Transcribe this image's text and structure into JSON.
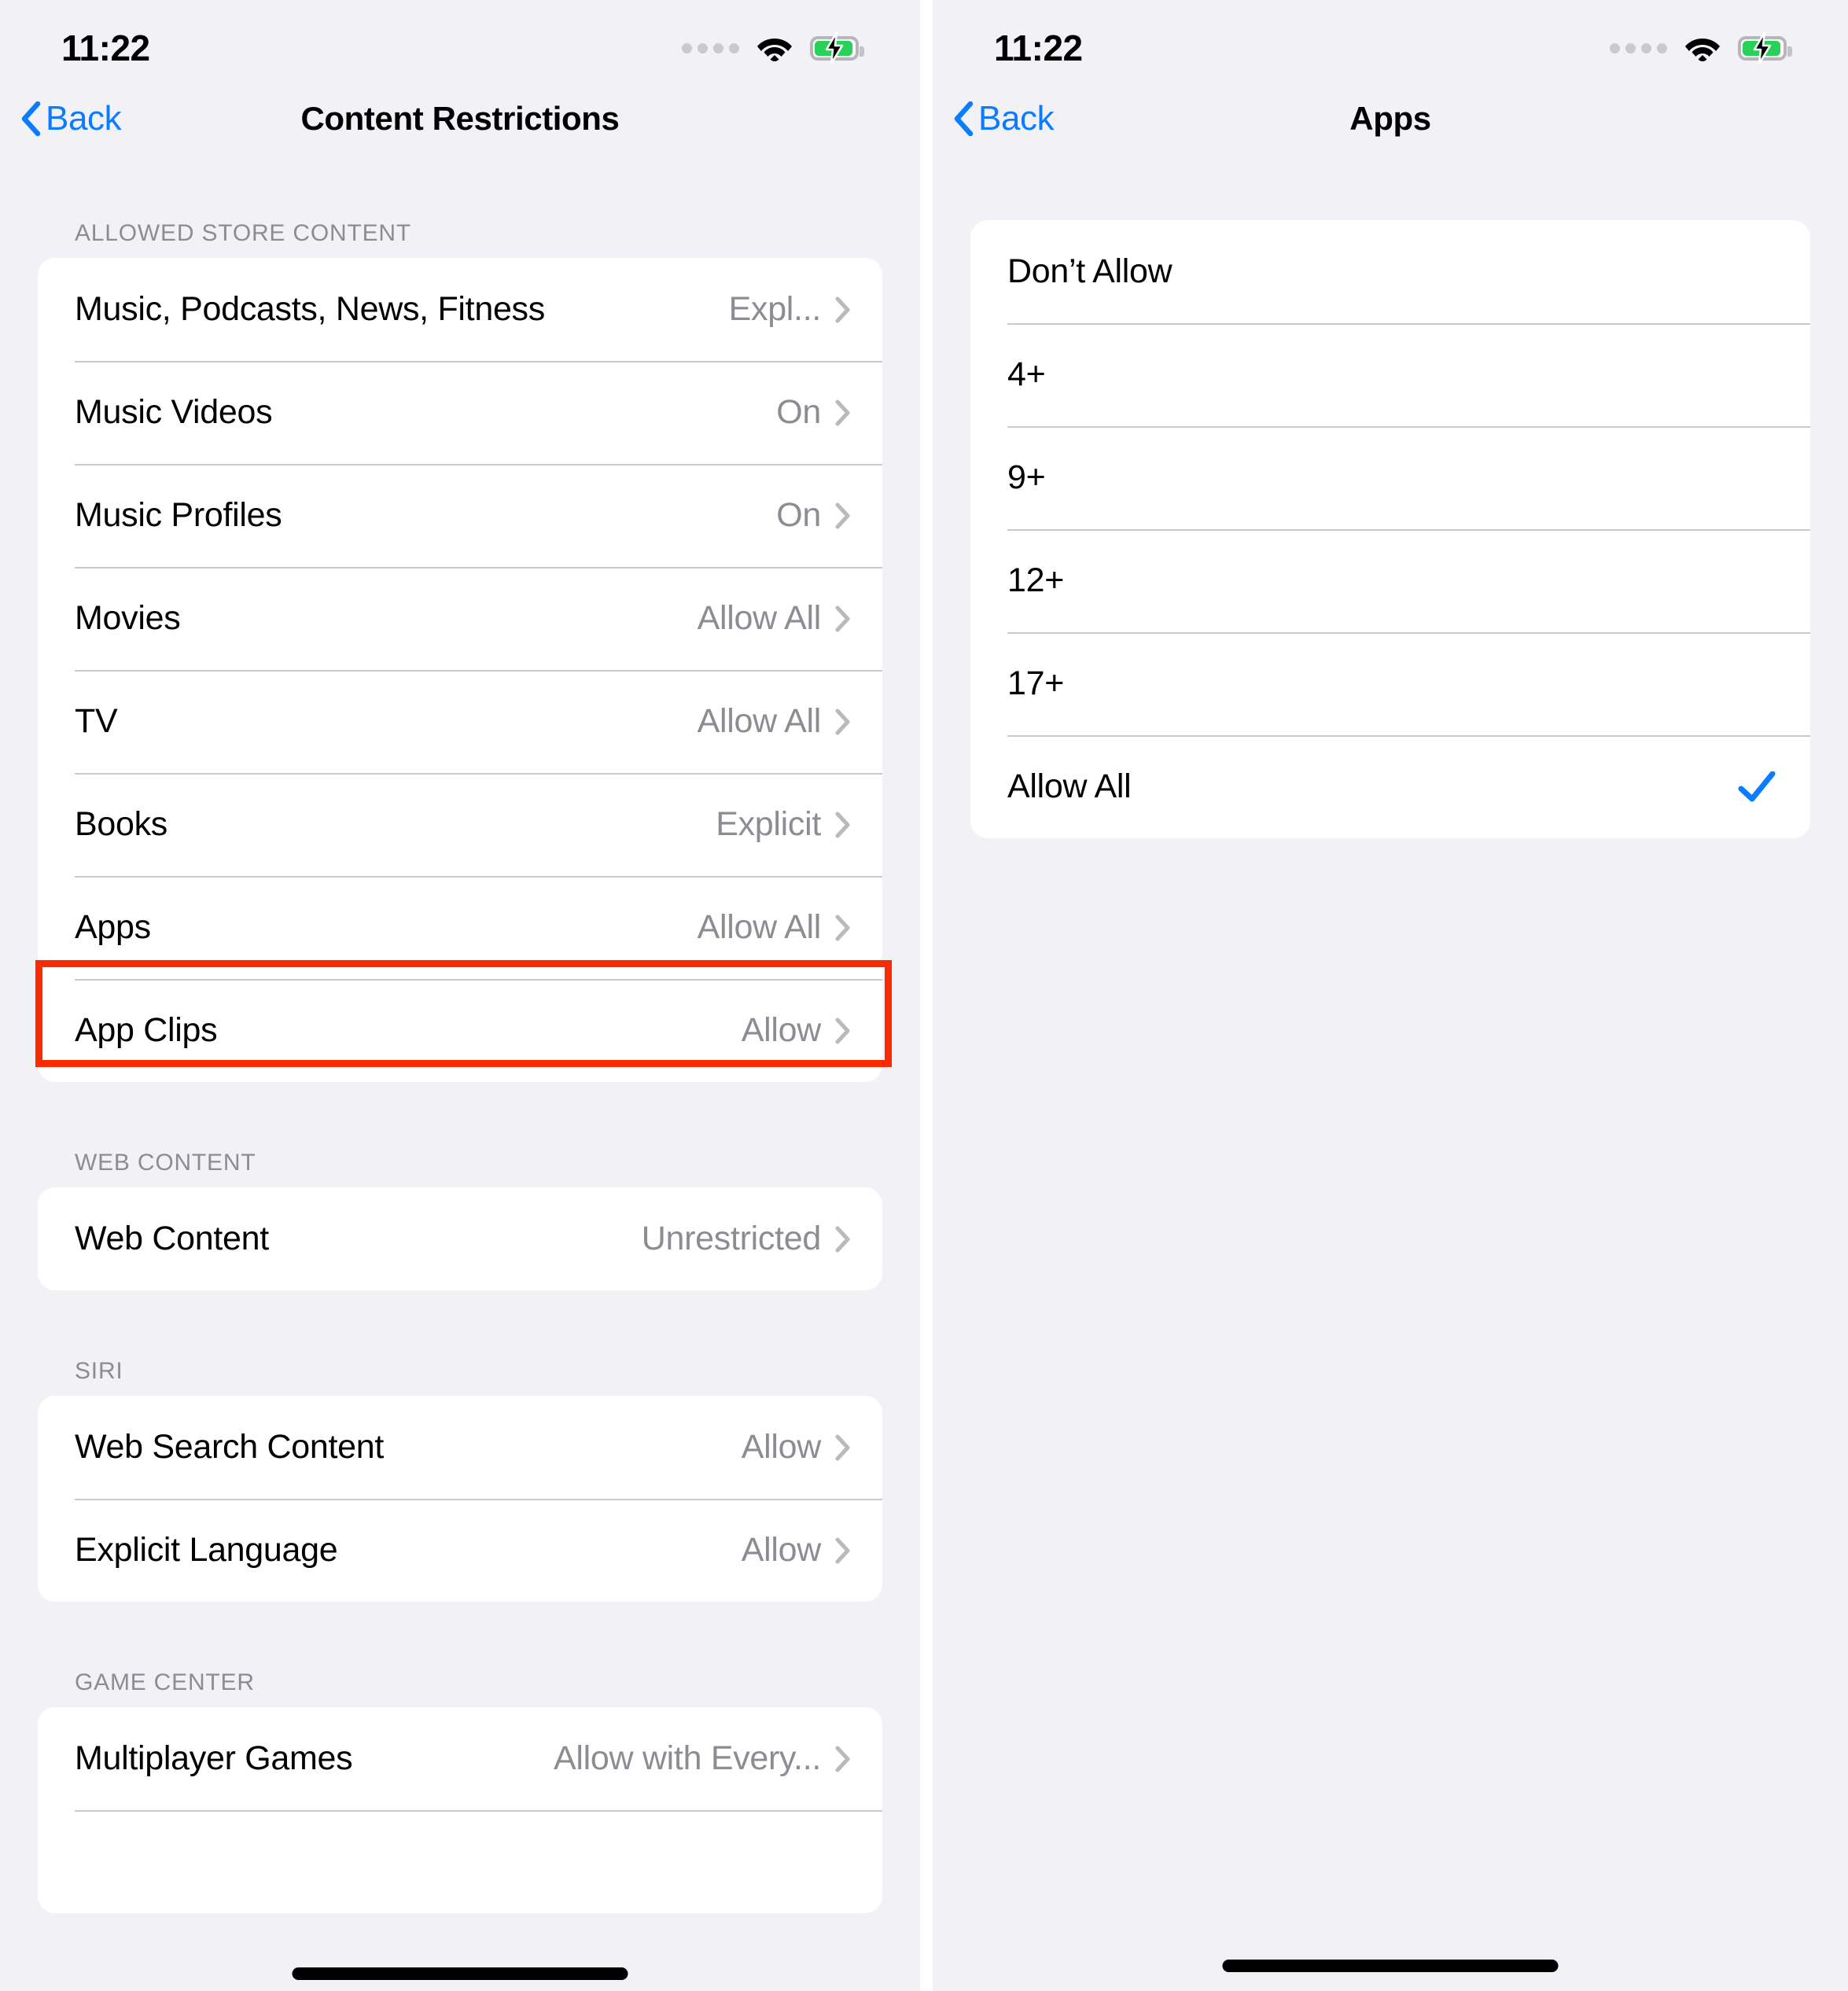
{
  "statusbar": {
    "time": "11:22",
    "cellular_icon": "cellular-dots-icon",
    "wifi_icon": "wifi-icon",
    "battery_icon": "battery-charging-icon"
  },
  "accent_color": "#0a7cff",
  "annotation_color": "#fc2a00",
  "value_color": "#8c8c92",
  "left_screen": {
    "nav": {
      "back_label": "Back",
      "title": "Content Restrictions"
    },
    "sections": [
      {
        "header": "ALLOWED STORE CONTENT",
        "rows": [
          {
            "label": "Music, Podcasts, News, Fitness",
            "value": "Expl..."
          },
          {
            "label": "Music Videos",
            "value": "On"
          },
          {
            "label": "Music Profiles",
            "value": "On"
          },
          {
            "label": "Movies",
            "value": "Allow All"
          },
          {
            "label": "TV",
            "value": "Allow All"
          },
          {
            "label": "Books",
            "value": "Explicit"
          },
          {
            "label": "Apps",
            "value": "Allow All",
            "highlighted": true
          },
          {
            "label": "App Clips",
            "value": "Allow"
          }
        ]
      },
      {
        "header": "WEB CONTENT",
        "rows": [
          {
            "label": "Web Content",
            "value": "Unrestricted"
          }
        ]
      },
      {
        "header": "SIRI",
        "rows": [
          {
            "label": "Web Search Content",
            "value": "Allow"
          },
          {
            "label": "Explicit Language",
            "value": "Allow"
          }
        ]
      },
      {
        "header": "GAME CENTER",
        "rows": [
          {
            "label": "Multiplayer Games",
            "value": "Allow with Every..."
          }
        ]
      }
    ]
  },
  "right_screen": {
    "nav": {
      "back_label": "Back",
      "title": "Apps"
    },
    "options": [
      {
        "label": "Don’t Allow",
        "selected": false
      },
      {
        "label": "4+",
        "selected": false
      },
      {
        "label": "9+",
        "selected": false
      },
      {
        "label": "12+",
        "selected": false
      },
      {
        "label": "17+",
        "selected": false
      },
      {
        "label": "Allow All",
        "selected": true,
        "highlighted": true
      }
    ]
  }
}
